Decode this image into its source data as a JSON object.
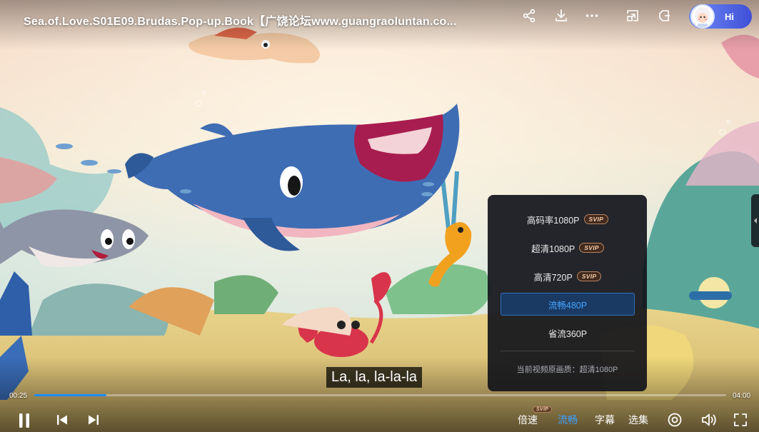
{
  "video": {
    "title": "Sea.of.Love.S01E09.Brudas.Pop-up.Book【广饶论坛www.guangraoluntan.co...",
    "subtitle": "La, la, la-la-la",
    "current_time": "00:25",
    "duration": "04:00",
    "progress_fraction": 0.104
  },
  "top_bar": {
    "icons": [
      "share-icon",
      "download-icon",
      "more-icon",
      "picture-in-picture-icon",
      "mini-window-icon"
    ],
    "user_greeting": "Hi"
  },
  "quality_menu": {
    "options": [
      {
        "label": "高码率1080P",
        "badge": "SVIP",
        "selected": false
      },
      {
        "label": "超清1080P",
        "badge": "SVIP",
        "selected": false
      },
      {
        "label": "高清720P",
        "badge": "SVIP",
        "selected": false
      },
      {
        "label": "流畅480P",
        "badge": "",
        "selected": true
      },
      {
        "label": "省流360P",
        "badge": "",
        "selected": false
      }
    ],
    "original_quality_note": "当前视频原画质：超清1080P"
  },
  "controls": {
    "speed_label": "倍速",
    "speed_badge": "SVIP",
    "quality_label": "流畅",
    "subtitle_label": "字幕",
    "episodes_label": "选集"
  },
  "colors": {
    "accent_blue": "#1d8cff",
    "selected_text": "#43a3ff",
    "panel_bg": "#12141a"
  }
}
